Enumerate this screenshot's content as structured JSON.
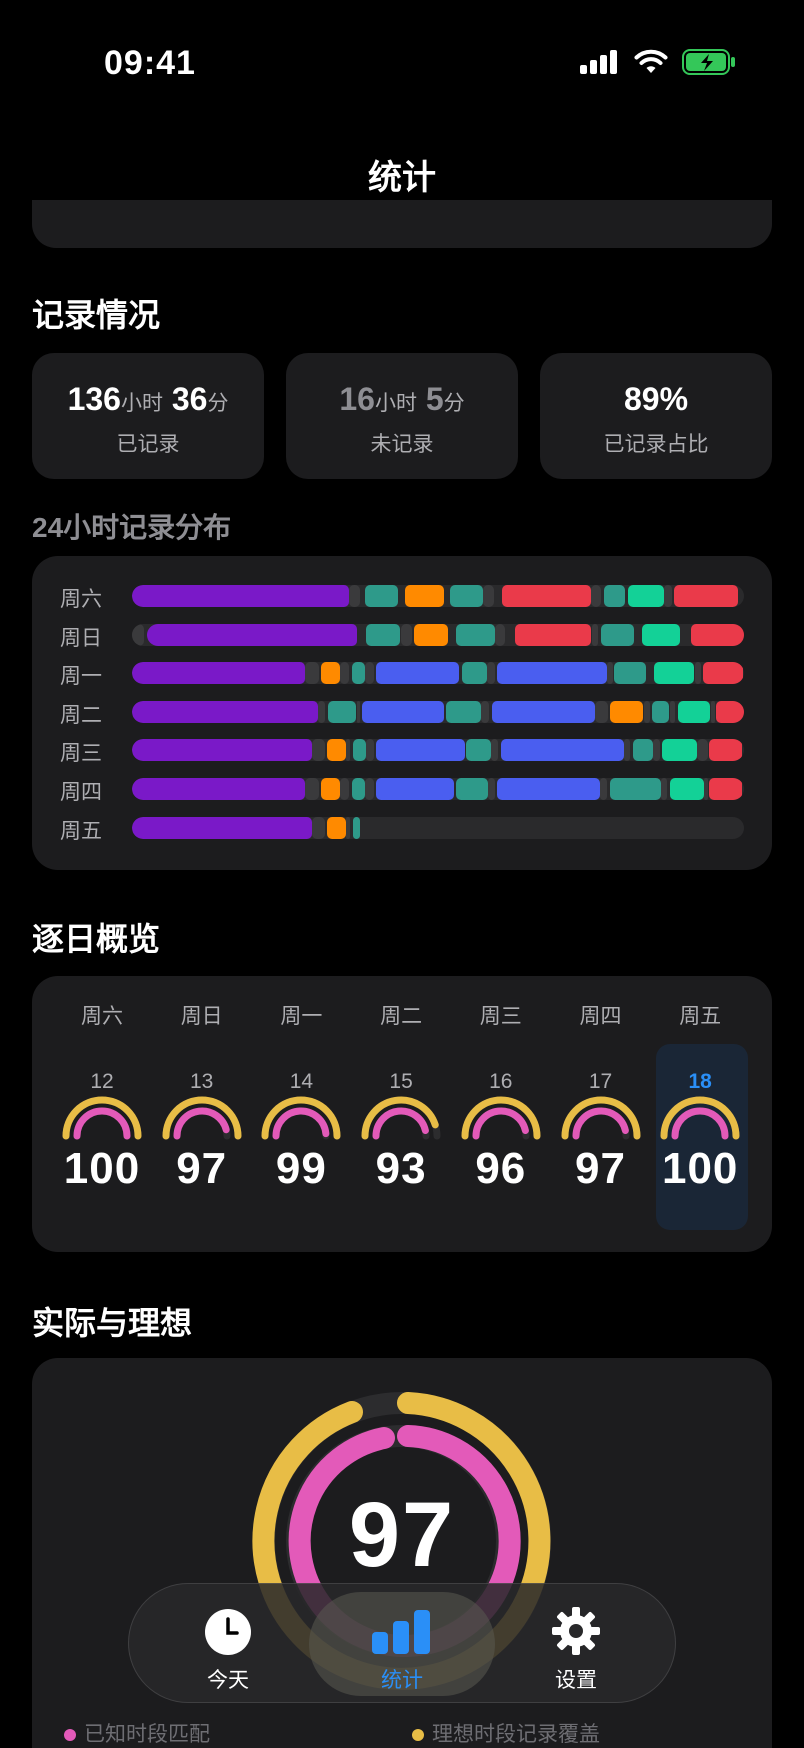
{
  "status": {
    "time": "09:41"
  },
  "nav": {
    "title": "统计"
  },
  "recording": {
    "title": "记录情况",
    "recorded": {
      "hours": "136",
      "h_unit": "小时",
      "mins": "36",
      "m_unit": "分",
      "label": "已记录"
    },
    "unrecorded": {
      "hours": "16",
      "h_unit": "小时",
      "mins": "5",
      "m_unit": "分",
      "label": "未记录"
    },
    "ratio": {
      "value": "89%",
      "label": "已记录占比"
    }
  },
  "distribution": {
    "title": "24小时记录分布",
    "colors": {
      "purple": "#7a19c8",
      "teal": "#2e9a8a",
      "orange": "#ff8a00",
      "red": "#ea3a4a",
      "green": "#13d197",
      "blue": "#4a5ef0",
      "gray": "#3a3a3c"
    },
    "rows": [
      {
        "day": "周六",
        "segments": [
          [
            "purple",
            0,
            35.4
          ],
          [
            "gray",
            35.4,
            37.3
          ],
          [
            "teal",
            38,
            43.5
          ],
          [
            "orange",
            44.6,
            51
          ],
          [
            "teal",
            52,
            57.3
          ],
          [
            "gray",
            57.3,
            59.1
          ],
          [
            "red",
            60.5,
            75
          ],
          [
            "gray",
            75,
            76.7
          ],
          [
            "teal",
            77.2,
            80.5
          ],
          [
            "green",
            81,
            87
          ],
          [
            "gray",
            87,
            88.2
          ],
          [
            "red",
            88.6,
            99
          ]
        ]
      },
      {
        "day": "周日",
        "segments": [
          [
            "gray",
            0,
            2
          ],
          [
            "purple",
            2.4,
            36.8
          ],
          [
            "teal",
            38.3,
            43.8
          ],
          [
            "gray",
            44,
            45.7
          ],
          [
            "orange",
            46.1,
            51.6
          ],
          [
            "teal",
            53,
            59.3
          ],
          [
            "gray",
            59.3,
            61
          ],
          [
            "red",
            62.5,
            75
          ],
          [
            "gray",
            75.1,
            76.2
          ],
          [
            "teal",
            76.6,
            82
          ],
          [
            "green",
            83.3,
            89.5
          ],
          [
            "red",
            91.3,
            100
          ]
        ]
      },
      {
        "day": "周一",
        "segments": [
          [
            "purple",
            0,
            28.3
          ],
          [
            "gray",
            28.3,
            30.5
          ],
          [
            "orange",
            30.9,
            34
          ],
          [
            "gray",
            34,
            35.4
          ],
          [
            "teal",
            35.9,
            38
          ],
          [
            "gray",
            38,
            39.5
          ],
          [
            "blue",
            39.9,
            53.5
          ],
          [
            "teal",
            54,
            58
          ],
          [
            "gray",
            58,
            59.3
          ],
          [
            "blue",
            59.6,
            77.6
          ],
          [
            "gray",
            77.6,
            78.6
          ],
          [
            "teal",
            78.8,
            84
          ],
          [
            "green",
            85.3,
            91.8
          ],
          [
            "gray",
            92,
            93
          ],
          [
            "red",
            93.3,
            99.8
          ]
        ]
      },
      {
        "day": "周二",
        "segments": [
          [
            "purple",
            0,
            30.4
          ],
          [
            "gray",
            30.4,
            31.6
          ],
          [
            "teal",
            32,
            36.6
          ],
          [
            "gray",
            36.7,
            37.2
          ],
          [
            "blue",
            37.5,
            51
          ],
          [
            "teal",
            51.3,
            57
          ],
          [
            "gray",
            57,
            58.4
          ],
          [
            "blue",
            58.8,
            75.7
          ],
          [
            "gray",
            75.7,
            77.8
          ],
          [
            "orange",
            78.1,
            83.5
          ],
          [
            "gray",
            83.6,
            84.6
          ],
          [
            "teal",
            84.9,
            87.8
          ],
          [
            "gray",
            87.9,
            88.8
          ],
          [
            "green",
            89.2,
            94.5
          ],
          [
            "gray",
            94.6,
            95.2
          ],
          [
            "red",
            95.5,
            100
          ]
        ]
      },
      {
        "day": "周三",
        "segments": [
          [
            "purple",
            0,
            29.4
          ],
          [
            "gray",
            29.4,
            31.6
          ],
          [
            "orange",
            31.9,
            35
          ],
          [
            "gray",
            35,
            35.7
          ],
          [
            "teal",
            36.1,
            38.3
          ],
          [
            "gray",
            38.3,
            39.5
          ],
          [
            "blue",
            39.9,
            54.4
          ],
          [
            "teal",
            54.6,
            58.7
          ],
          [
            "gray",
            58.7,
            59.8
          ],
          [
            "blue",
            60.3,
            80.4
          ],
          [
            "gray",
            80.4,
            81.4
          ],
          [
            "teal",
            81.9,
            85.1
          ],
          [
            "gray",
            85.1,
            86.3
          ],
          [
            "green",
            86.6,
            92.3
          ],
          [
            "gray",
            92.3,
            94.1
          ],
          [
            "red",
            94.3,
            99.7
          ]
        ]
      },
      {
        "day": "周四",
        "segments": [
          [
            "purple",
            0,
            28.3
          ],
          [
            "gray",
            28.3,
            30.5
          ],
          [
            "orange",
            30.9,
            34
          ],
          [
            "gray",
            34,
            35.4
          ],
          [
            "teal",
            35.9,
            38
          ],
          [
            "gray",
            38,
            39.5
          ],
          [
            "blue",
            39.9,
            52.6
          ],
          [
            "teal",
            52.9,
            58.1
          ],
          [
            "gray",
            58.1,
            59.3
          ],
          [
            "blue",
            59.6,
            76.5
          ],
          [
            "gray",
            76.5,
            77.6
          ],
          [
            "teal",
            78.1,
            86.4
          ],
          [
            "gray",
            86.5,
            87.4
          ],
          [
            "green",
            87.9,
            93.4
          ],
          [
            "gray",
            93.4,
            94.1
          ],
          [
            "red",
            94.3,
            99.7
          ]
        ]
      },
      {
        "day": "周五",
        "segments": [
          [
            "purple",
            0,
            29.4
          ],
          [
            "gray",
            29.4,
            31.6
          ],
          [
            "orange",
            31.9,
            35
          ],
          [
            "gray",
            35,
            35.7
          ],
          [
            "teal",
            36.1,
            37.3
          ]
        ]
      }
    ]
  },
  "daily": {
    "title": "逐日概览",
    "days": [
      {
        "weekday": "周六",
        "date": "12",
        "score": "100",
        "outer": 1.0,
        "inner": 1.0,
        "selected": false
      },
      {
        "weekday": "周日",
        "date": "13",
        "score": "97",
        "outer": 1.0,
        "inner": 0.92,
        "selected": false
      },
      {
        "weekday": "周一",
        "date": "14",
        "score": "99",
        "outer": 1.0,
        "inner": 0.97,
        "selected": false
      },
      {
        "weekday": "周二",
        "date": "15",
        "score": "93",
        "outer": 0.9,
        "inner": 0.93,
        "selected": false
      },
      {
        "weekday": "周三",
        "date": "16",
        "score": "96",
        "outer": 1.0,
        "inner": 0.93,
        "selected": false
      },
      {
        "weekday": "周四",
        "date": "17",
        "score": "97",
        "outer": 1.0,
        "inner": 0.93,
        "selected": false
      },
      {
        "weekday": "周五",
        "date": "18",
        "score": "100",
        "outer": 1.0,
        "inner": 1.0,
        "selected": true
      }
    ]
  },
  "actual_vs_ideal": {
    "title": "实际与理想",
    "score": "97",
    "legend": {
      "known_match": "已知时段匹配",
      "ideal_coverage": "理想时段记录覆盖"
    }
  },
  "tabs": [
    {
      "label": "今天",
      "icon": "clock-icon",
      "active": false
    },
    {
      "label": "统计",
      "icon": "bar-chart-icon",
      "active": true
    },
    {
      "label": "设置",
      "icon": "gear-icon",
      "active": false
    }
  ],
  "colors": {
    "gold": "#e8bd46",
    "pink": "#e35ab9",
    "accent": "#2a8ff7"
  }
}
